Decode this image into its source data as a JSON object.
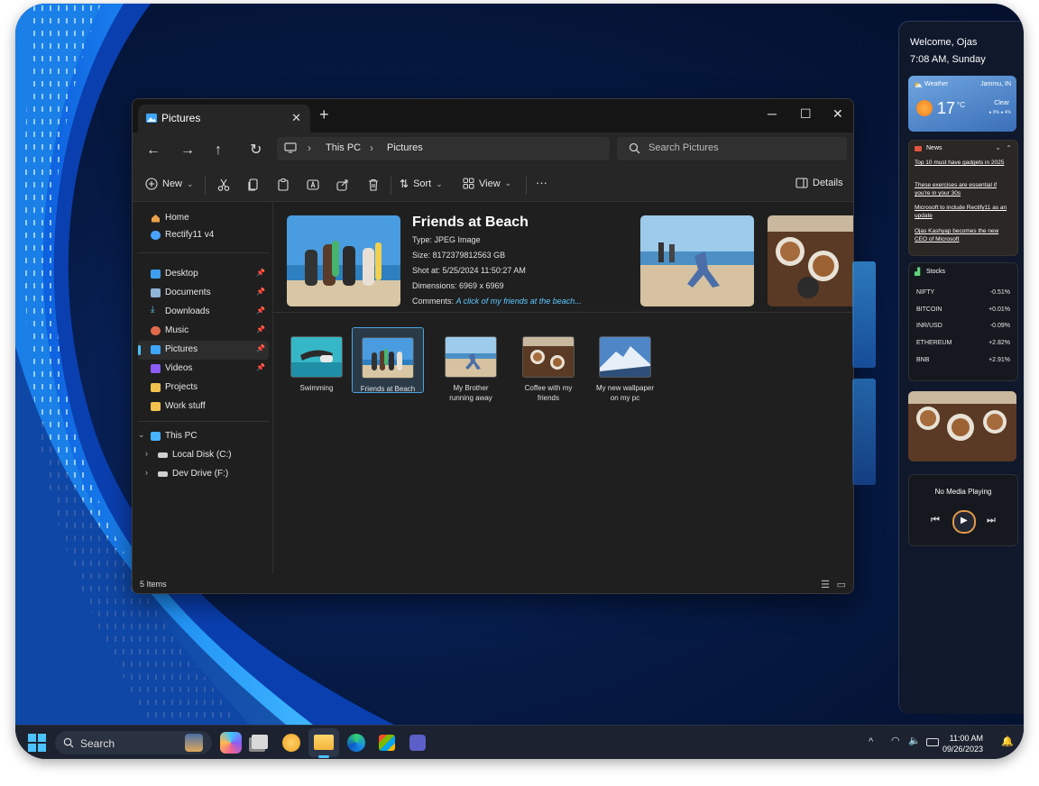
{
  "window": {
    "tab_title": "Pictures",
    "tab_close": "✕",
    "new_tab": "+",
    "minimize": "─",
    "maximize": "☐",
    "close": "✕"
  },
  "nav": {
    "back": "←",
    "forward": "→",
    "up": "↑",
    "refresh": "↻",
    "crumb_1": "This PC",
    "crumb_2": "Pictures",
    "chevron": "›",
    "search_placeholder": "Search Pictures"
  },
  "toolbar": {
    "new_label": "New",
    "sort_label": "Sort",
    "view_label": "View",
    "more": "···",
    "details_label": "Details"
  },
  "sidebar": {
    "items": [
      {
        "label": "Home",
        "color": "#e9a04a"
      },
      {
        "label": "Rectify11 v4",
        "color": "#4aa3ff"
      },
      {
        "label": "Desktop",
        "color": "#3e9ef0"
      },
      {
        "label": "Documents",
        "color": "#8fb3d9"
      },
      {
        "label": "Downloads",
        "color": "#5bd0f0"
      },
      {
        "label": "Music",
        "color": "#e06a4a"
      },
      {
        "label": "Pictures",
        "color": "#3ea6ff"
      },
      {
        "label": "Videos",
        "color": "#8b5cf6"
      },
      {
        "label": "Projects",
        "color": "#f2c14e"
      },
      {
        "label": "Work stuff",
        "color": "#f2c14e"
      },
      {
        "label": "This PC",
        "color": "#48b3ff"
      },
      {
        "label": "Local Disk (C:)",
        "color": "#cfcfcf"
      },
      {
        "label": "Dev Drive (F:)",
        "color": "#cfcfcf"
      }
    ]
  },
  "preview": {
    "title": "Friends at Beach",
    "type": "Type: JPEG Image",
    "size": "Size: 8172379812563 GB",
    "shot_at": "Shot at: 5/25/2024 11:50:27 AM",
    "dimensions": "Dimensions: 6969 x 6969",
    "comments_label": "Comments: ",
    "comments_value": "A click of my friends at the beach..."
  },
  "files": [
    {
      "line1": "Swimming",
      "line2": ""
    },
    {
      "line1": "Friends at Beach",
      "line2": ""
    },
    {
      "line1": "My Brother",
      "line2": "running away"
    },
    {
      "line1": "Coffee with my",
      "line2": "friends"
    },
    {
      "line1": "My new wallpaper",
      "line2": "on my pc"
    }
  ],
  "status": {
    "count": "5 Items"
  },
  "widgets": {
    "welcome": "Welcome, Ojas",
    "time_day": "7:08 AM, Sunday",
    "weather": {
      "label": "Weather",
      "location": "Jammu, IN",
      "temp": "17",
      "unit": "°C",
      "condition": "Clear",
      "extra": "● 9%  ● 4%"
    },
    "news": {
      "label": "News",
      "items": [
        "Top 10 must have gadgets in 2025",
        "These exercises are essential if you're in your 30s",
        "Microsoft to include Rectify11 as an update",
        "Ojas Kashyap becomes the new CEO of Microsoft"
      ]
    },
    "stocks": {
      "label": "Stocks",
      "rows": [
        {
          "name": "NIFTY",
          "change": "-0.51%"
        },
        {
          "name": "BITCOIN",
          "change": "+0.01%"
        },
        {
          "name": "INR/USD",
          "change": "-0.09%"
        },
        {
          "name": "ETHEREUM",
          "change": "+2.82%"
        },
        {
          "name": "BNB",
          "change": "+2.91%"
        }
      ]
    },
    "media": {
      "status": "No Media Playing"
    }
  },
  "taskbar": {
    "search_placeholder": "Search",
    "time": "11:00 AM",
    "date": "09/26/2023",
    "overflow": "^"
  },
  "colors": {
    "accent": "#4cc2ff",
    "link": "#60c7ff"
  }
}
